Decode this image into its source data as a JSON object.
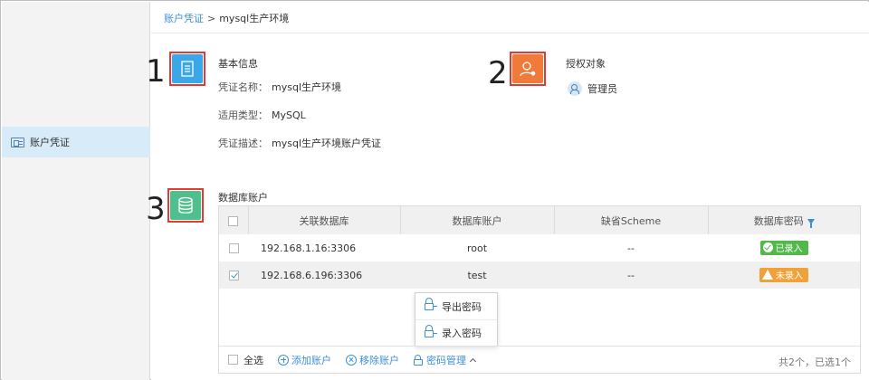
{
  "sidebar": {
    "items": [
      {
        "label": "账户凭证"
      }
    ]
  },
  "breadcrumb": {
    "link": "账户凭证",
    "separator": ">",
    "current": "mysql生产环境"
  },
  "markers": [
    "1",
    "2",
    "3"
  ],
  "basic_info": {
    "title": "基本信息",
    "name_label": "凭证名称：",
    "name_value": "mysql生产环境",
    "type_label": "适用类型：",
    "type_value": "MySQL",
    "desc_label": "凭证描述：",
    "desc_value": "mysql生产环境账户凭证"
  },
  "grant": {
    "title": "授权对象",
    "items": [
      {
        "label": "管理员"
      }
    ]
  },
  "db_accounts": {
    "title": "数据库账户",
    "columns": [
      "关联数据库",
      "数据库账户",
      "缺省Scheme",
      "数据库密码"
    ],
    "rows": [
      {
        "host": "192.168.1.16:3306",
        "account": "root",
        "scheme": "--",
        "status": "已录入",
        "checked": false
      },
      {
        "host": "192.168.6.196:3306",
        "account": "test",
        "scheme": "--",
        "status": "未录入",
        "checked": true
      }
    ]
  },
  "dropdown": {
    "items": [
      "导出密码",
      "录入密码"
    ]
  },
  "footer": {
    "select_all": "全选",
    "add": "添加账户",
    "remove": "移除账户",
    "password_mgmt": "密码管理",
    "summary": "共2个，已选1个"
  },
  "colors": {
    "accent": "#3d8fd6",
    "icon_info": "#3aa8e8",
    "icon_grant": "#f07a3a",
    "icon_db": "#4fc08d",
    "ok": "#52b84a",
    "warn": "#f0a23a",
    "marker_border": "#e53935"
  },
  "icons": [
    "document-icon",
    "user-settings-icon",
    "database-icon",
    "id-card-icon",
    "users-icon",
    "filter-icon",
    "lock-export-icon",
    "lock-import-icon",
    "plus-circle-icon",
    "x-circle-icon",
    "lock-icon",
    "chevron-up-icon"
  ]
}
